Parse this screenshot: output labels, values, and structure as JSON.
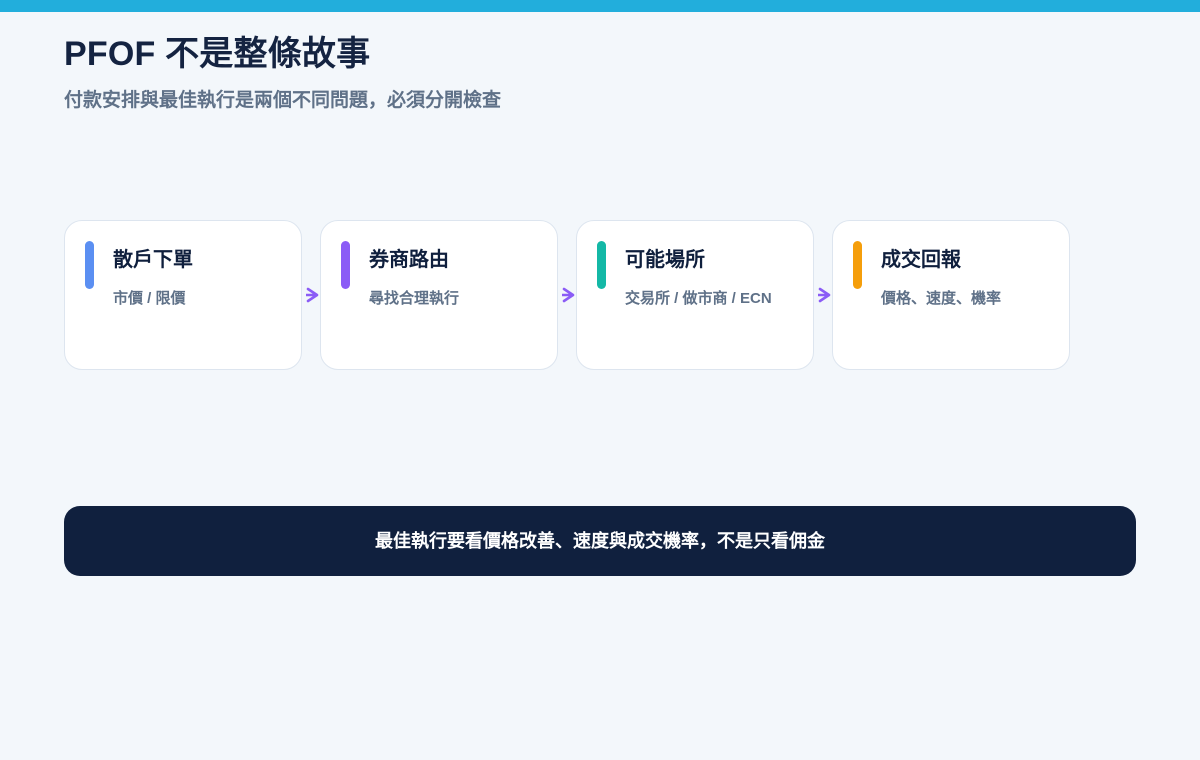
{
  "header": {
    "title": "PFOF 不是整條故事",
    "subtitle": "付款安排與最佳執行是兩個不同問題，必須分開檢查"
  },
  "flow": {
    "steps": [
      {
        "title": "散戶下單",
        "description": "市價 / 限價",
        "accent_color": "#5b8ff2"
      },
      {
        "title": "券商路由",
        "description": "尋找合理執行",
        "accent_color": "#8b5cf6"
      },
      {
        "title": "可能場所",
        "description": "交易所 / 做市商 / ECN",
        "accent_color": "#14b8a6"
      },
      {
        "title": "成交回報",
        "description": "價格、速度、機率",
        "accent_color": "#f59e0b"
      }
    ],
    "arrow_color": "#8b5cf6",
    "arrow_icon": "chevron-right-icon"
  },
  "summary": {
    "text": "最佳執行要看價格改善、速度與成交機率，不是只看佣金"
  },
  "colors": {
    "top_bar": "#22aedc",
    "background": "#f3f7fb",
    "banner": "#10203e"
  }
}
